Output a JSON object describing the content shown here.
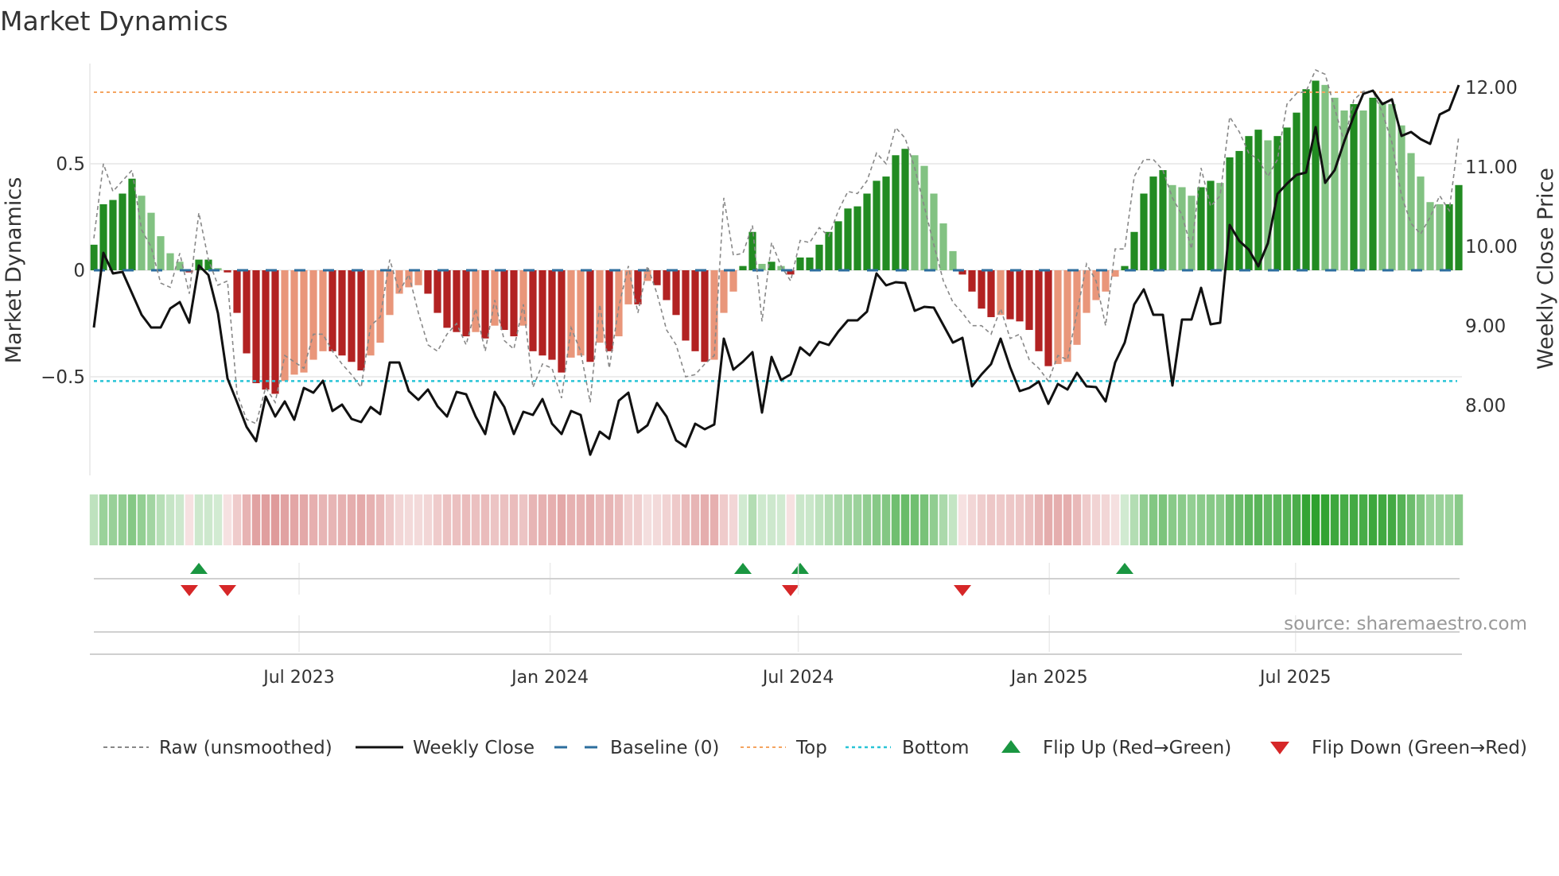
{
  "chart_data": {
    "type": "bar",
    "title": "Market Dynamics",
    "ylabel": "Market Dynamics",
    "y2label": "Weekly Close Price",
    "ylim": [
      -0.98,
      1.0
    ],
    "y2lim": [
      7.1,
      12.3
    ],
    "yticks": [
      {
        "v": 0.5,
        "label": "0.5"
      },
      {
        "v": 0,
        "label": "0"
      },
      {
        "v": -0.5,
        "label": "−0.5"
      }
    ],
    "y2ticks": [
      {
        "v": 12,
        "label": "12.00"
      },
      {
        "v": 11,
        "label": "11.00"
      },
      {
        "v": 10,
        "label": "10.00"
      },
      {
        "v": 9,
        "label": "9.00"
      },
      {
        "v": 8,
        "label": "8.00"
      }
    ],
    "xticks": [
      {
        "week": 21.5,
        "label": "Jul 2023"
      },
      {
        "week": 47.8,
        "label": "Jan 2024"
      },
      {
        "week": 73.8,
        "label": "Jul 2024"
      },
      {
        "week": 100.1,
        "label": "Jan 2025"
      },
      {
        "week": 125.9,
        "label": "Jul 2025"
      }
    ],
    "top_level": 0.836,
    "bottom_level": -0.52,
    "baseline": 0,
    "smoothed": [
      0.12,
      0.31,
      0.33,
      0.36,
      0.43,
      0.35,
      0.27,
      0.16,
      0.08,
      0.04,
      -0.01,
      0.05,
      0.05,
      0.01,
      -0.01,
      -0.2,
      -0.39,
      -0.53,
      -0.56,
      -0.58,
      -0.52,
      -0.49,
      -0.48,
      -0.42,
      -0.38,
      -0.38,
      -0.4,
      -0.43,
      -0.47,
      -0.4,
      -0.34,
      -0.21,
      -0.11,
      -0.08,
      -0.07,
      -0.11,
      -0.2,
      -0.27,
      -0.29,
      -0.31,
      -0.29,
      -0.32,
      -0.26,
      -0.28,
      -0.31,
      -0.26,
      -0.38,
      -0.4,
      -0.42,
      -0.48,
      -0.41,
      -0.4,
      -0.43,
      -0.34,
      -0.38,
      -0.31,
      -0.16,
      -0.16,
      -0.05,
      -0.07,
      -0.14,
      -0.21,
      -0.33,
      -0.38,
      -0.43,
      -0.42,
      -0.2,
      -0.1,
      0.02,
      0.18,
      0.03,
      0.04,
      0.02,
      -0.02,
      0.06,
      0.06,
      0.12,
      0.18,
      0.23,
      0.29,
      0.3,
      0.36,
      0.42,
      0.44,
      0.54,
      0.57,
      0.54,
      0.49,
      0.36,
      0.22,
      0.09,
      -0.02,
      -0.1,
      -0.18,
      -0.22,
      -0.21,
      -0.23,
      -0.24,
      -0.28,
      -0.38,
      -0.45,
      -0.44,
      -0.43,
      -0.35,
      -0.2,
      -0.14,
      -0.1,
      -0.03,
      0.02,
      0.18,
      0.36,
      0.44,
      0.47,
      0.4,
      0.39,
      0.35,
      0.39,
      0.42,
      0.41,
      0.53,
      0.56,
      0.63,
      0.66,
      0.61,
      0.63,
      0.67,
      0.74,
      0.85,
      0.89,
      0.87,
      0.81,
      0.75,
      0.78,
      0.75,
      0.81,
      0.79,
      0.78,
      0.68,
      0.55,
      0.44,
      0.32,
      0.31,
      0.31,
      0.4
    ],
    "raw": [
      0.15,
      0.5,
      0.37,
      0.42,
      0.47,
      0.19,
      0.11,
      -0.06,
      -0.08,
      0.08,
      -0.11,
      0.27,
      0.05,
      -0.07,
      -0.05,
      -0.58,
      -0.7,
      -0.72,
      -0.55,
      -0.62,
      -0.4,
      -0.43,
      -0.46,
      -0.3,
      -0.3,
      -0.38,
      -0.44,
      -0.49,
      -0.55,
      -0.26,
      -0.22,
      0.05,
      -0.1,
      -0.02,
      -0.2,
      -0.35,
      -0.38,
      -0.3,
      -0.25,
      -0.35,
      -0.18,
      -0.38,
      -0.14,
      -0.33,
      -0.37,
      -0.16,
      -0.55,
      -0.44,
      -0.46,
      -0.6,
      -0.27,
      -0.38,
      -0.62,
      -0.16,
      -0.46,
      -0.17,
      0.02,
      -0.2,
      0.02,
      -0.11,
      -0.28,
      -0.35,
      -0.5,
      -0.49,
      -0.44,
      -0.4,
      0.34,
      0.07,
      0.08,
      0.21,
      -0.24,
      0.13,
      0.02,
      -0.05,
      0.14,
      0.13,
      0.2,
      0.16,
      0.28,
      0.37,
      0.36,
      0.42,
      0.55,
      0.5,
      0.67,
      0.62,
      0.48,
      0.3,
      0.12,
      -0.05,
      -0.15,
      -0.2,
      -0.26,
      -0.26,
      -0.3,
      -0.18,
      -0.32,
      -0.3,
      -0.42,
      -0.46,
      -0.52,
      -0.4,
      -0.42,
      -0.2,
      0.03,
      -0.05,
      -0.26,
      0.1,
      0.1,
      0.44,
      0.52,
      0.52,
      0.47,
      0.34,
      0.26,
      0.1,
      0.48,
      0.3,
      0.35,
      0.72,
      0.65,
      0.55,
      0.52,
      0.44,
      0.52,
      0.78,
      0.83,
      0.84,
      0.94,
      0.92,
      0.76,
      0.6,
      0.8,
      0.84,
      0.84,
      0.74,
      0.6,
      0.35,
      0.22,
      0.17,
      0.25,
      0.35,
      0.28,
      0.63
    ],
    "weekly_close": [
      8.98,
      9.92,
      9.66,
      9.68,
      9.41,
      9.14,
      8.98,
      8.98,
      9.22,
      9.3,
      9.04,
      9.76,
      9.64,
      9.16,
      8.34,
      8.04,
      7.73,
      7.55,
      8.11,
      7.86,
      8.05,
      7.82,
      8.22,
      8.16,
      8.31,
      7.93,
      8.01,
      7.83,
      7.79,
      7.98,
      7.89,
      8.54,
      8.54,
      8.18,
      8.07,
      8.2,
      7.99,
      7.86,
      8.17,
      8.14,
      7.86,
      7.64,
      8.17,
      7.98,
      7.64,
      7.92,
      7.88,
      8.08,
      7.77,
      7.64,
      7.93,
      7.88,
      7.38,
      7.67,
      7.58,
      8.06,
      8.16,
      7.66,
      7.75,
      8.03,
      7.86,
      7.56,
      7.48,
      7.77,
      7.7,
      7.76,
      8.84,
      8.45,
      8.55,
      8.67,
      7.91,
      8.61,
      8.32,
      8.39,
      8.73,
      8.63,
      8.8,
      8.76,
      8.93,
      9.07,
      9.07,
      9.18,
      9.66,
      9.51,
      9.55,
      9.54,
      9.19,
      9.24,
      9.23,
      9.01,
      8.79,
      8.85,
      8.24,
      8.39,
      8.52,
      8.84,
      8.48,
      8.18,
      8.22,
      8.3,
      8.02,
      8.27,
      8.2,
      8.41,
      8.24,
      8.23,
      8.05,
      8.54,
      8.79,
      9.27,
      9.46,
      9.14,
      9.14,
      8.25,
      9.08,
      9.08,
      9.48,
      9.02,
      9.04,
      10.27,
      10.07,
      9.96,
      9.75,
      10.04,
      10.66,
      10.79,
      10.9,
      10.93,
      11.5,
      10.8,
      10.96,
      11.32,
      11.64,
      11.92,
      11.96,
      11.79,
      11.85,
      11.39,
      11.44,
      11.35,
      11.29,
      11.66,
      11.72,
      12.03
    ],
    "flip_up_weeks": [
      11,
      68,
      74,
      108
    ],
    "flip_down_weeks": [
      10,
      14,
      73,
      91
    ],
    "legend": {
      "position": "bottom",
      "items": [
        {
          "label": "Raw (unsmoothed)",
          "kind": "raw"
        },
        {
          "label": "Weekly Close",
          "kind": "close"
        },
        {
          "label": "Baseline (0)",
          "kind": "baseline"
        },
        {
          "label": "Top",
          "kind": "top"
        },
        {
          "label": "Bottom",
          "kind": "bottom"
        },
        {
          "label": "Flip Up (Red→Green)",
          "kind": "up"
        },
        {
          "label": "Flip Down (Green→Red)",
          "kind": "down"
        }
      ]
    },
    "source": "source: sharemaestro.com",
    "colors": {
      "green_strong": "#228b22",
      "green_weak": "#82c282",
      "red_strong": "#b22222",
      "red_weak": "#e9967a",
      "baseline": "#2c6e9e",
      "top": "#f4a460",
      "bottom": "#28c4d6",
      "up": "#1a9641",
      "down": "#d62728",
      "raw": "#888888",
      "close": "#111111"
    }
  }
}
